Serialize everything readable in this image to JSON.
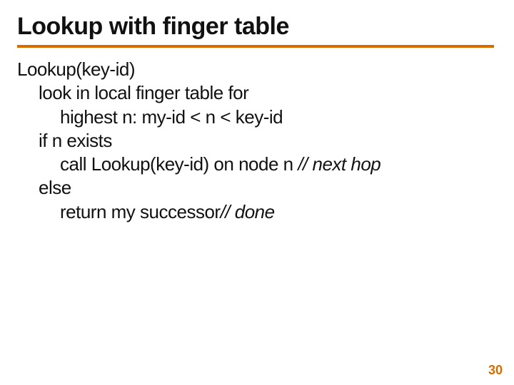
{
  "title": "Lookup with finger table",
  "algo": {
    "l1": "Lookup(key-id)",
    "l2": "look in local finger table for",
    "l3": "highest n: my-id < n < key-id",
    "l4": "if n exists",
    "l5a": "call Lookup(key-id) on node n ",
    "l5b": "// next hop",
    "l6": "else",
    "l7a": "return my successor",
    "l7b": "// done"
  },
  "page_number": "30"
}
